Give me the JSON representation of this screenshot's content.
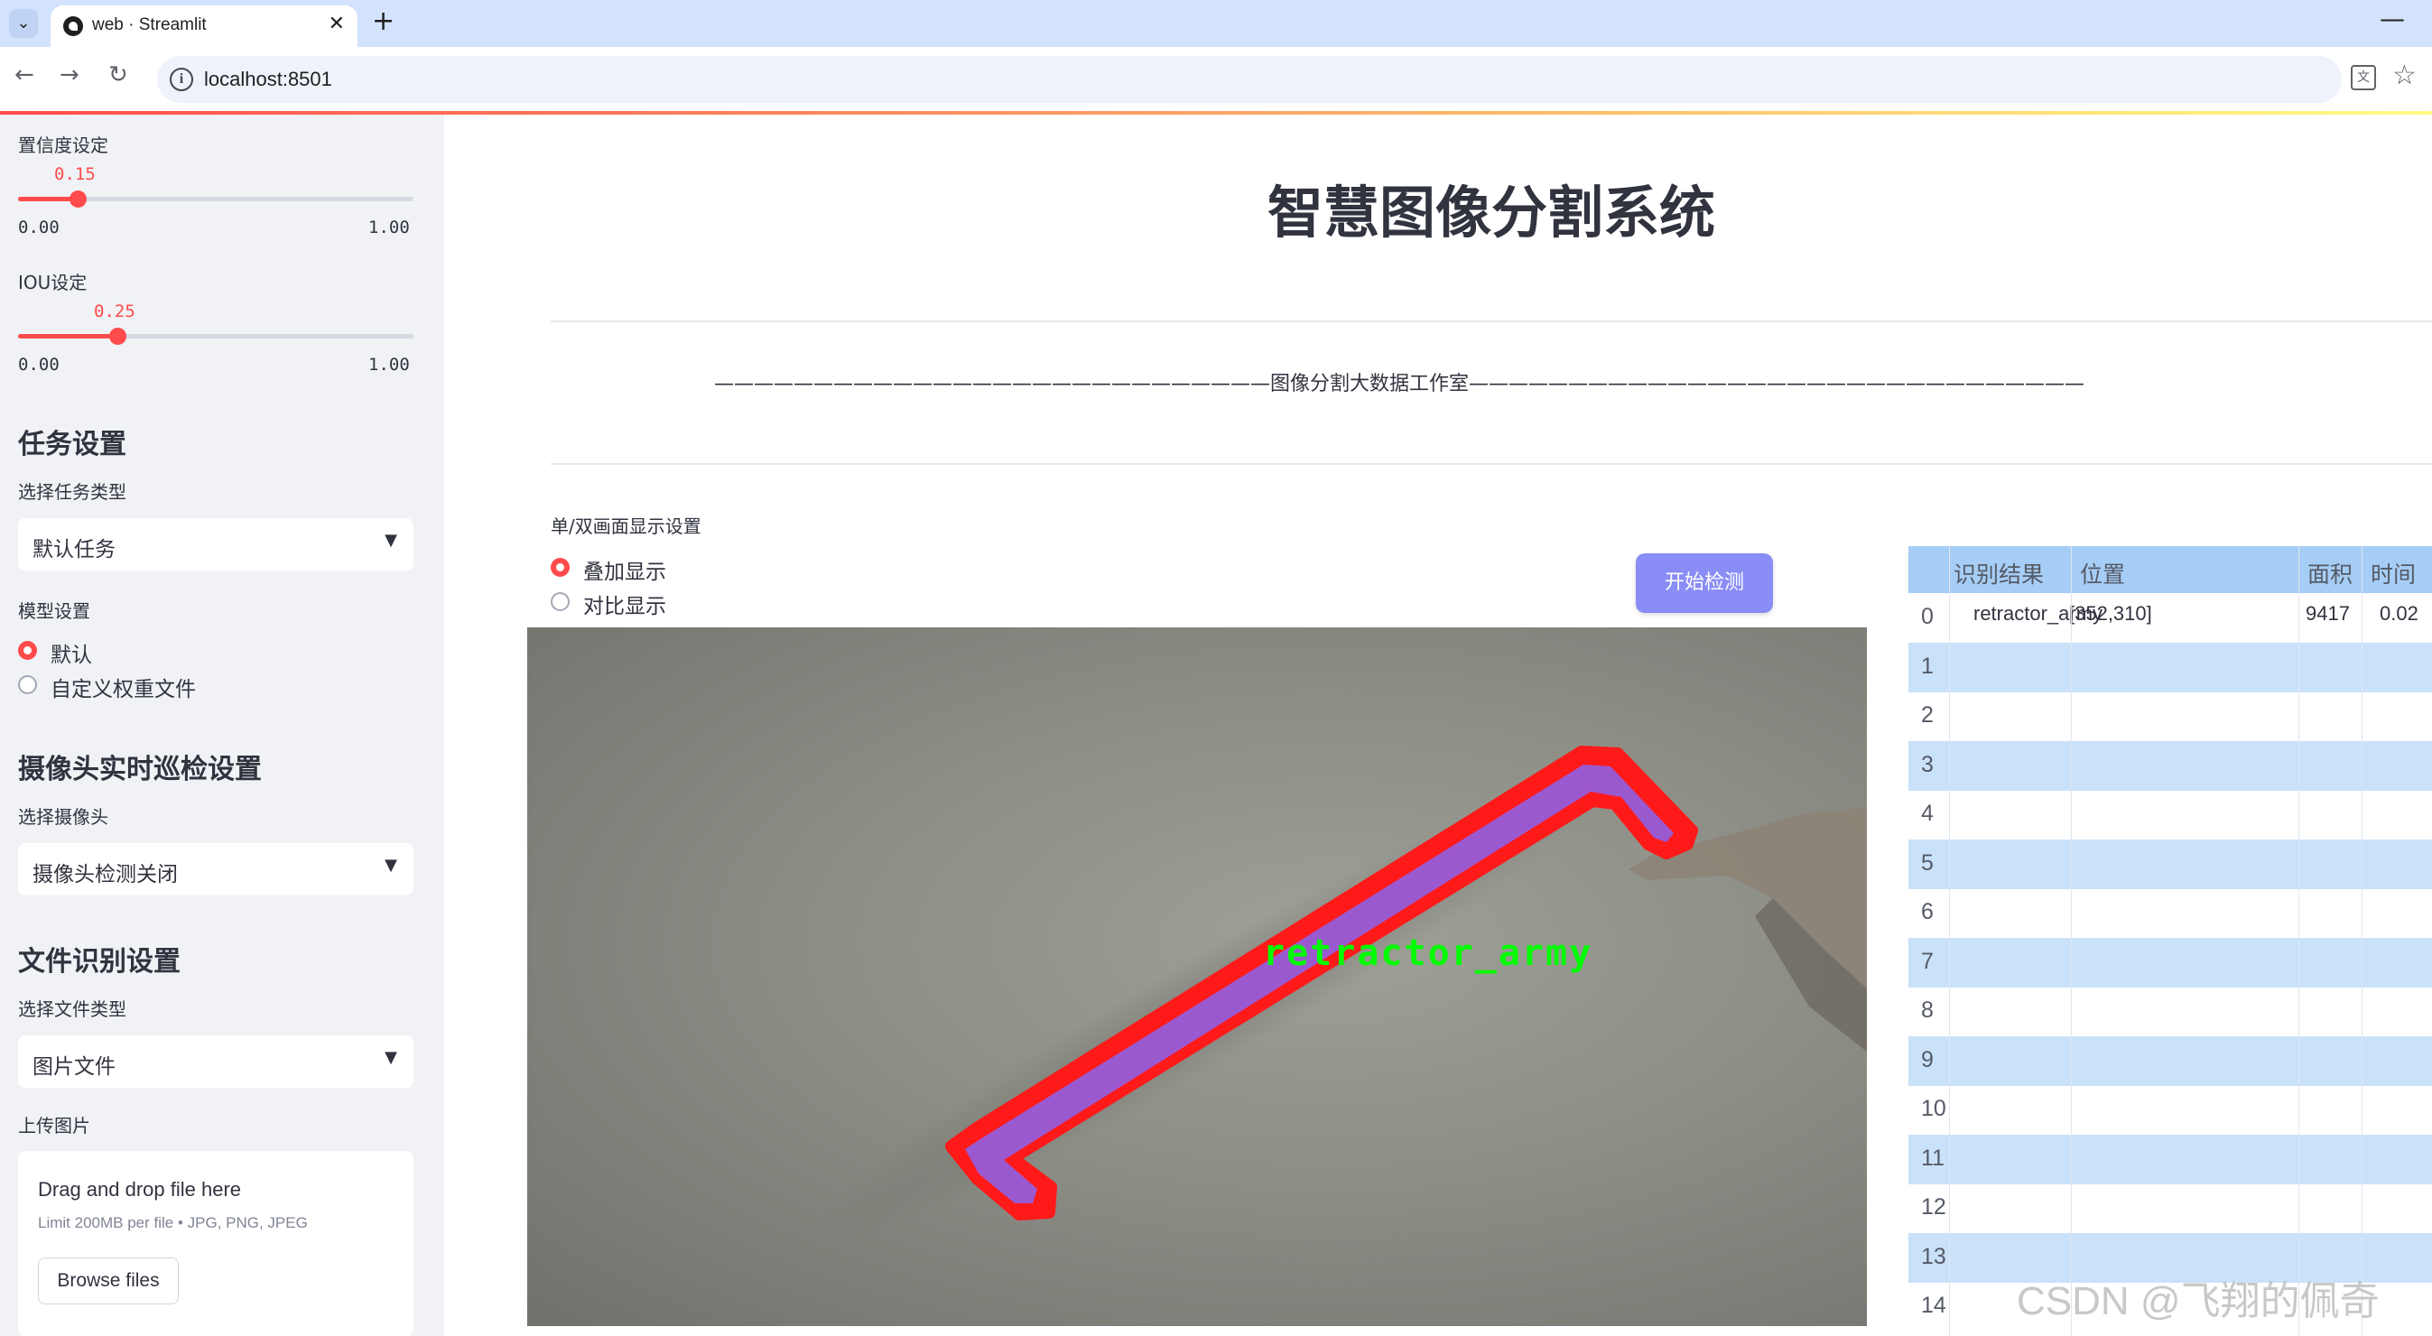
{
  "browser": {
    "tab_title": "web · Streamlit",
    "url": "localhost:8501"
  },
  "sidebar": {
    "confidence": {
      "label": "置信度设定",
      "value": "0.15",
      "fraction": 0.15,
      "min": "0.00",
      "max": "1.00"
    },
    "iou": {
      "label": "IOU设定",
      "value": "0.25",
      "fraction": 0.25,
      "min": "0.00",
      "max": "1.00"
    },
    "task_header": "任务设置",
    "task_type_label": "选择任务类型",
    "task_type_value": "默认任务",
    "model_label": "模型设置",
    "model_options": [
      "默认",
      "自定义权重文件"
    ],
    "model_selected": 0,
    "camera_header": "摄像头实时巡检设置",
    "camera_label": "选择摄像头",
    "camera_value": "摄像头检测关闭",
    "file_header": "文件识别设置",
    "file_type_label": "选择文件类型",
    "file_type_value": "图片文件",
    "upload_label": "上传图片",
    "upload_title": "Drag and drop file here",
    "upload_limit": "Limit 200MB per file • JPG, PNG, JPEG",
    "browse_label": "Browse files"
  },
  "main": {
    "title": "智慧图像分割系统",
    "divider_text": "————————————————————————————图像分割大数据工作室———————————————————————————————",
    "display_label": "单/双画面显示设置",
    "display_options": [
      "叠加显示",
      "对比显示"
    ],
    "display_selected": 0,
    "start_button": "开始检测",
    "detection_label": "retractor_army"
  },
  "table": {
    "columns": [
      "识别结果",
      "位置",
      "面积",
      "时间"
    ],
    "rows": [
      {
        "index": "0",
        "result": "retractor_army",
        "position": "[352,310]",
        "area": "9417",
        "time": "0.02"
      },
      {
        "index": "1"
      },
      {
        "index": "2"
      },
      {
        "index": "3"
      },
      {
        "index": "4"
      },
      {
        "index": "5"
      },
      {
        "index": "6"
      },
      {
        "index": "7"
      },
      {
        "index": "8"
      },
      {
        "index": "9"
      },
      {
        "index": "10"
      },
      {
        "index": "11"
      },
      {
        "index": "12"
      },
      {
        "index": "13"
      },
      {
        "index": "14"
      }
    ]
  },
  "watermark": "CSDN @飞翔的佩奇",
  "colors": {
    "accent": "#ff4b4b",
    "sidebar_bg": "#f0f2f6",
    "button": "#8a8df5",
    "mask_outline": "#ff1a1a",
    "mask_fill": "#9b59d0",
    "label_text": "#00ff00"
  }
}
